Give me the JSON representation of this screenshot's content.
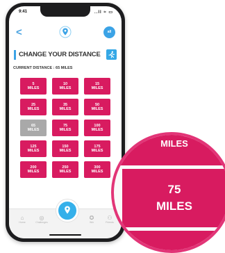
{
  "status": {
    "time": "9:41",
    "icons": "..ll ≈ ▭"
  },
  "nav": {
    "back_label": "<",
    "location_icon": "location-pin-icon",
    "account_initial": "all"
  },
  "header": {
    "title": "CHANGE YOUR DISTANCE",
    "action_icon": "runner-icon"
  },
  "current_distance": "CURRENT DISTANCE : 65 MILES",
  "distances": [
    {
      "value": "5",
      "unit": "MILES",
      "selected": false
    },
    {
      "value": "10",
      "unit": "MILES",
      "selected": false
    },
    {
      "value": "15",
      "unit": "MILES",
      "selected": false
    },
    {
      "value": "25",
      "unit": "MILES",
      "selected": false
    },
    {
      "value": "35",
      "unit": "MILES",
      "selected": false
    },
    {
      "value": "50",
      "unit": "MILES",
      "selected": false
    },
    {
      "value": "65",
      "unit": "MILES",
      "selected": true
    },
    {
      "value": "75",
      "unit": "MILES",
      "selected": false
    },
    {
      "value": "100",
      "unit": "MILES",
      "selected": false
    },
    {
      "value": "125",
      "unit": "MILES",
      "selected": false
    },
    {
      "value": "150",
      "unit": "MILES",
      "selected": false
    },
    {
      "value": "175",
      "unit": "MILES",
      "selected": false
    },
    {
      "value": "200",
      "unit": "MILES",
      "selected": false
    },
    {
      "value": "250",
      "unit": "MILES",
      "selected": false
    },
    {
      "value": "300",
      "unit": "MILES",
      "selected": false
    }
  ],
  "tabs": [
    {
      "label": "Home",
      "icon": "home-icon"
    },
    {
      "label": "Challenges",
      "icon": "globe-icon"
    },
    {
      "label": "Win",
      "icon": "badge-icon"
    },
    {
      "label": "Friends",
      "icon": "people-icon"
    }
  ],
  "magnifier": {
    "top_text": "MILES",
    "value": "75",
    "unit": "MILES"
  },
  "colors": {
    "tile": "#d81b60",
    "tile_selected": "#a9a9a9",
    "accent": "#3ba3e6"
  }
}
